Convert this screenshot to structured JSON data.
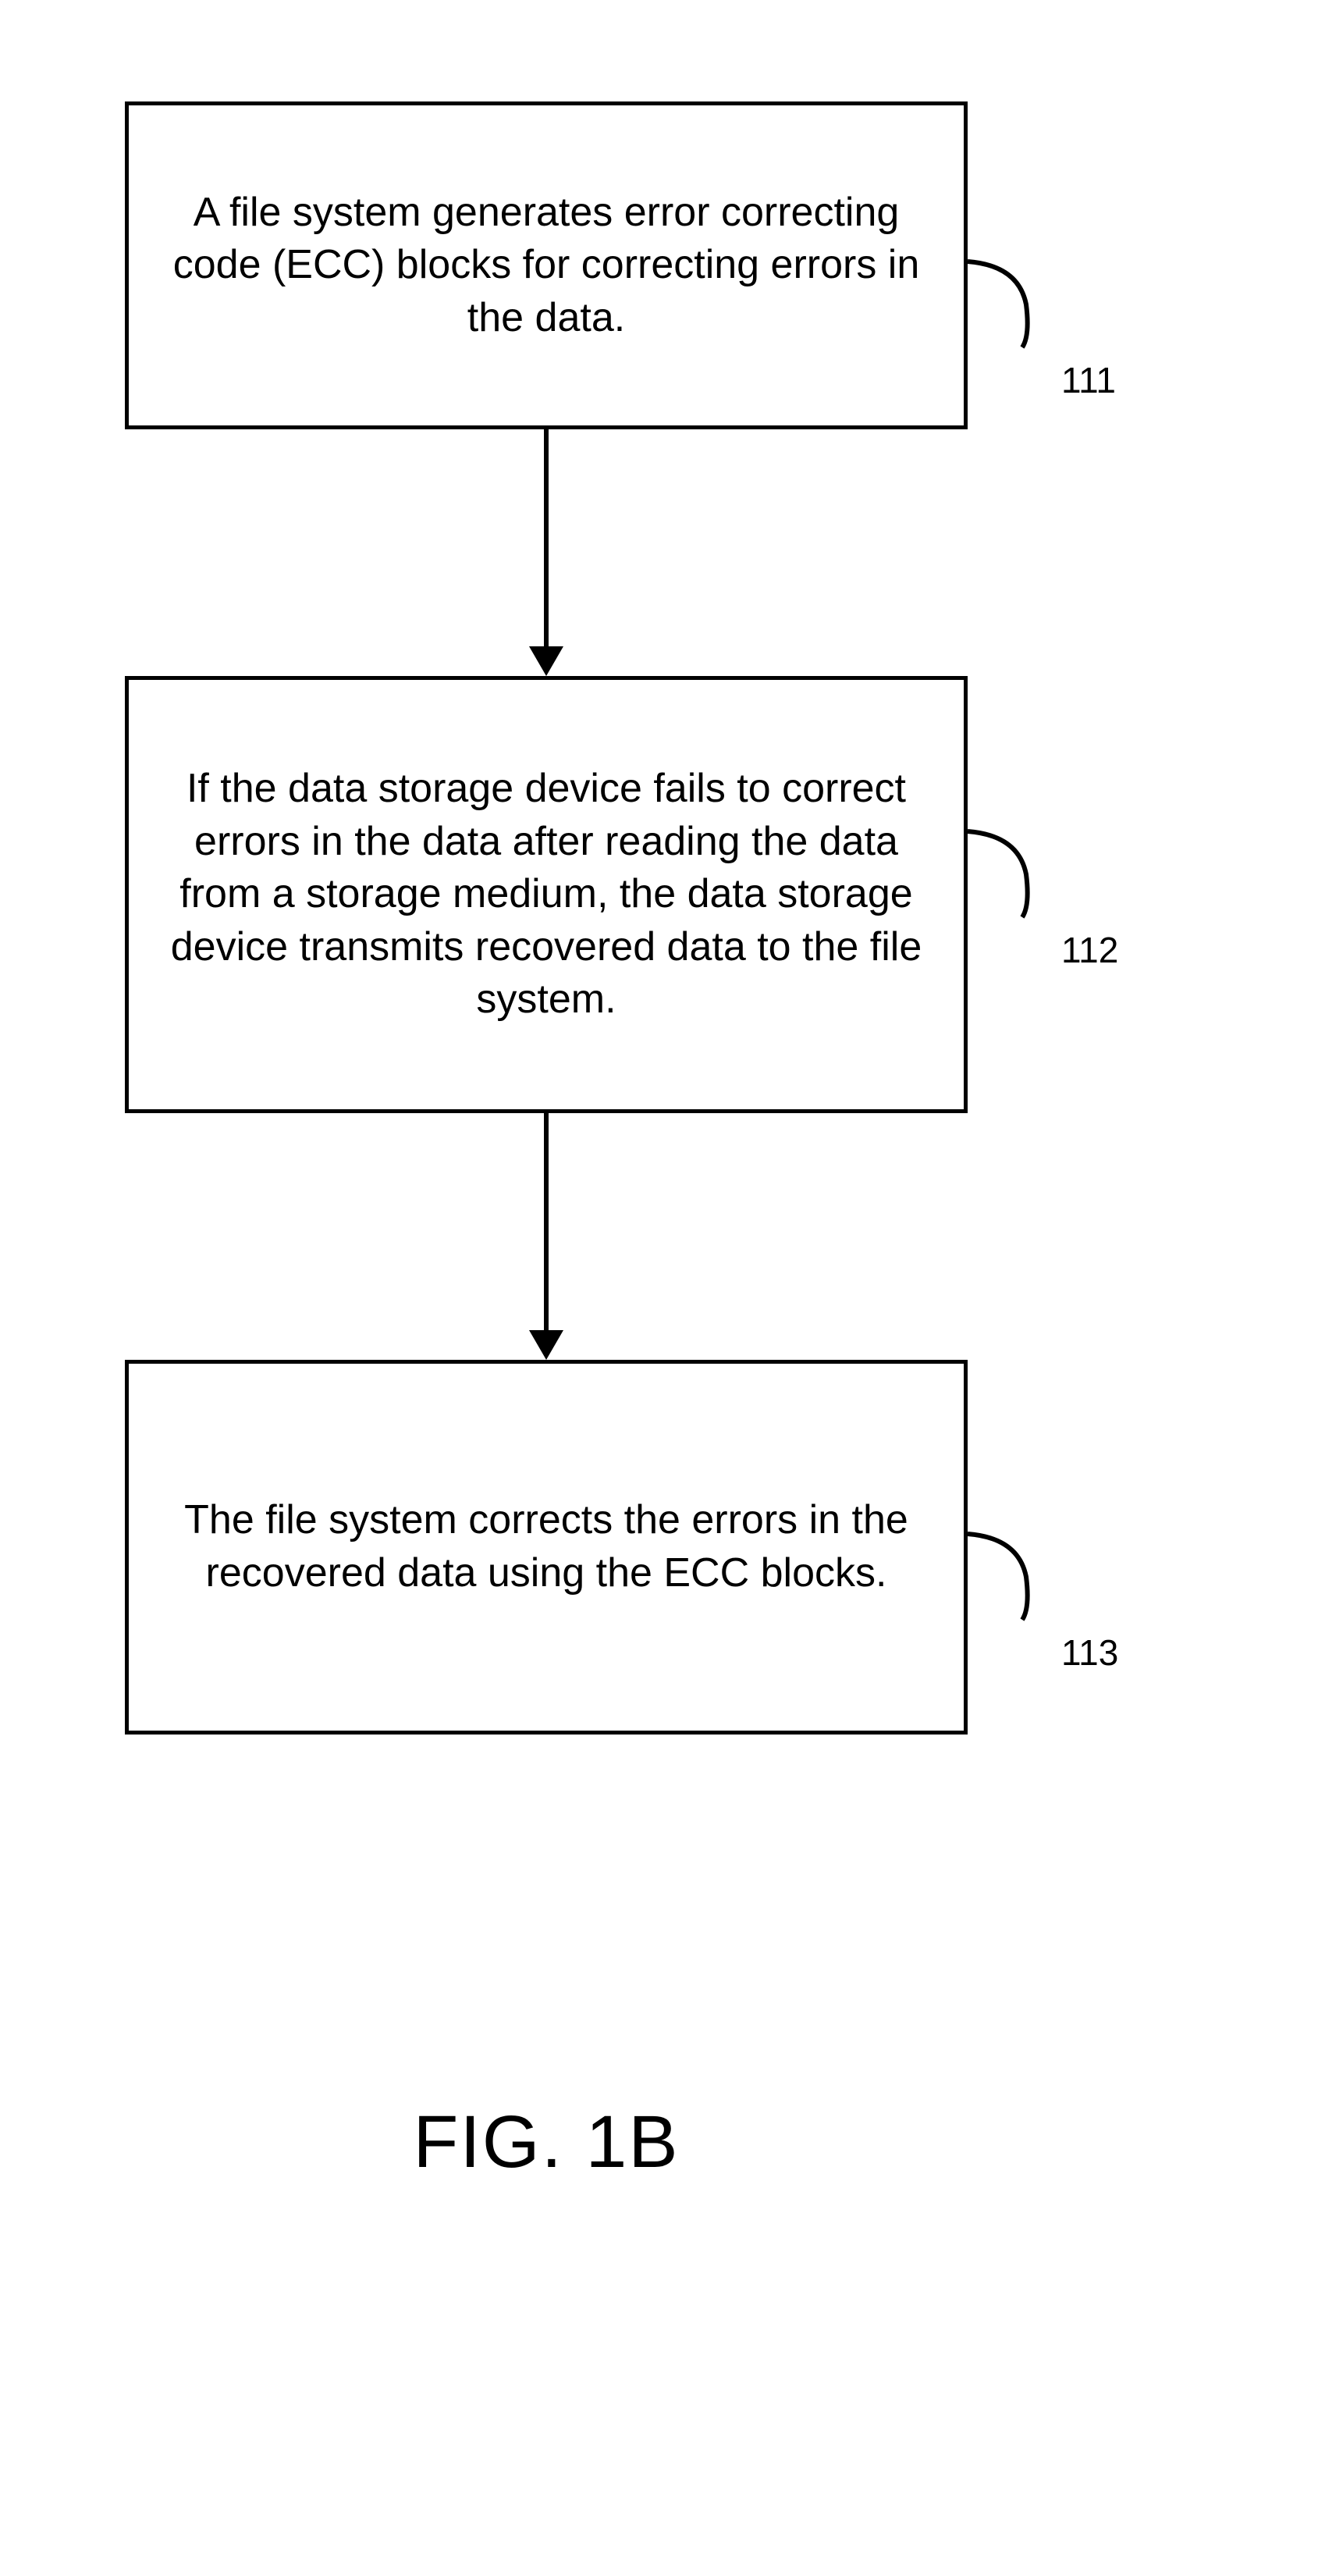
{
  "flowchart": {
    "boxes": [
      {
        "id": "box1",
        "text": "A file system generates error correcting code (ECC) blocks for correcting errors in the data.",
        "label": "111"
      },
      {
        "id": "box2",
        "text": "If the data storage device fails to correct errors in the data after reading the data from a storage medium, the data storage device transmits recovered data to the file system.",
        "label": "112"
      },
      {
        "id": "box3",
        "text": "The file system corrects the errors in the recovered data using the ECC blocks.",
        "label": "113"
      }
    ],
    "caption": "FIG. 1B"
  }
}
